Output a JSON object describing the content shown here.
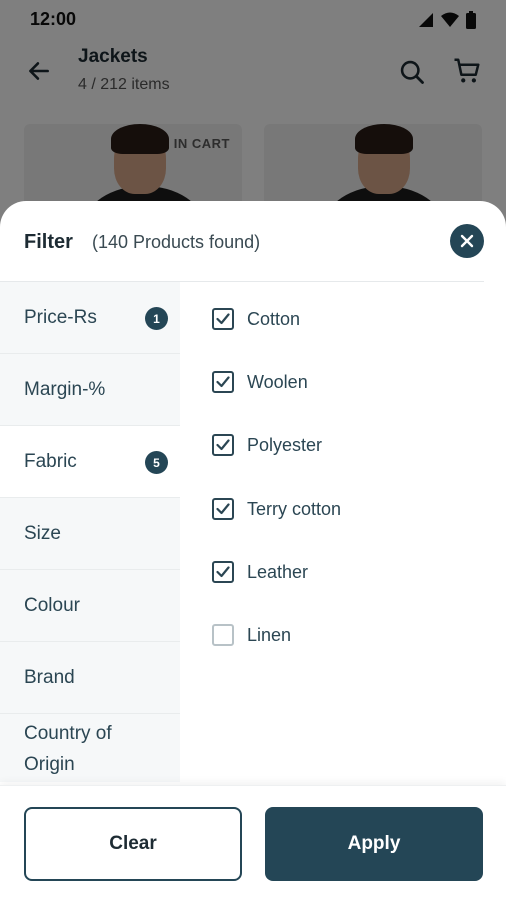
{
  "status_bar": {
    "time": "12:00"
  },
  "app_bar": {
    "title": "Jackets",
    "subtitle": "4 / 212 items"
  },
  "products": [
    {
      "badge": "IN CART"
    },
    {
      "badge": ""
    }
  ],
  "filter": {
    "title": "Filter",
    "count_text": "(140 Products found)",
    "categories": [
      {
        "label": "Price-Rs",
        "badge": "1",
        "active": false
      },
      {
        "label": "Margin-%",
        "badge": "",
        "active": false
      },
      {
        "label": "Fabric",
        "badge": "5",
        "active": true
      },
      {
        "label": "Size",
        "badge": "",
        "active": false
      },
      {
        "label": "Colour",
        "badge": "",
        "active": false
      },
      {
        "label": "Brand",
        "badge": "",
        "active": false
      },
      {
        "label": "Country of Origin",
        "badge": "",
        "active": false
      }
    ],
    "options": [
      {
        "label": "Cotton",
        "checked": true
      },
      {
        "label": "Woolen",
        "checked": true
      },
      {
        "label": "Polyester",
        "checked": true
      },
      {
        "label": "Terry cotton",
        "checked": true
      },
      {
        "label": "Leather",
        "checked": true
      },
      {
        "label": "Linen",
        "checked": false
      }
    ]
  },
  "footer": {
    "clear_label": "Clear",
    "apply_label": "Apply"
  },
  "colors": {
    "accent": "#244656",
    "text": "#2b4653",
    "panel": "#f6f8f9"
  },
  "icons": [
    "back-arrow-icon",
    "search-icon",
    "cart-icon",
    "close-icon",
    "check-icon",
    "signal-icon",
    "wifi-icon",
    "battery-icon"
  ]
}
